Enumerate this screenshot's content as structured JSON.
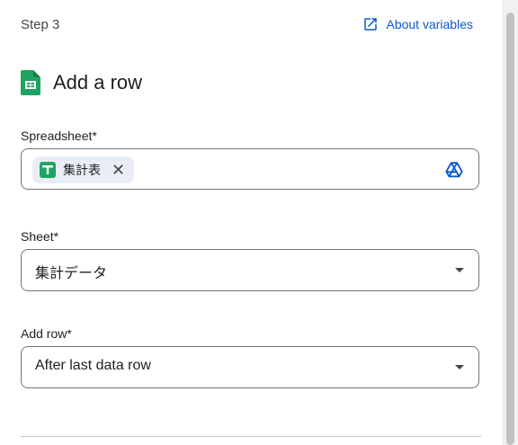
{
  "header": {
    "step_label": "Step 3",
    "about_link": "About variables"
  },
  "action": {
    "title": "Add a row",
    "app_icon": "google-sheets-icon"
  },
  "fields": {
    "spreadsheet": {
      "label": "Spreadsheet*",
      "chip_value": "集計表",
      "picker_icon": "google-drive-icon"
    },
    "sheet": {
      "label": "Sheet*",
      "value": "集計データ"
    },
    "add_row": {
      "label": "Add row*",
      "value": "After last data row"
    }
  },
  "colors": {
    "link": "#0b57d0",
    "sheets_green": "#1ea362",
    "chip_bg": "#e9eef6",
    "border": "#747775"
  }
}
